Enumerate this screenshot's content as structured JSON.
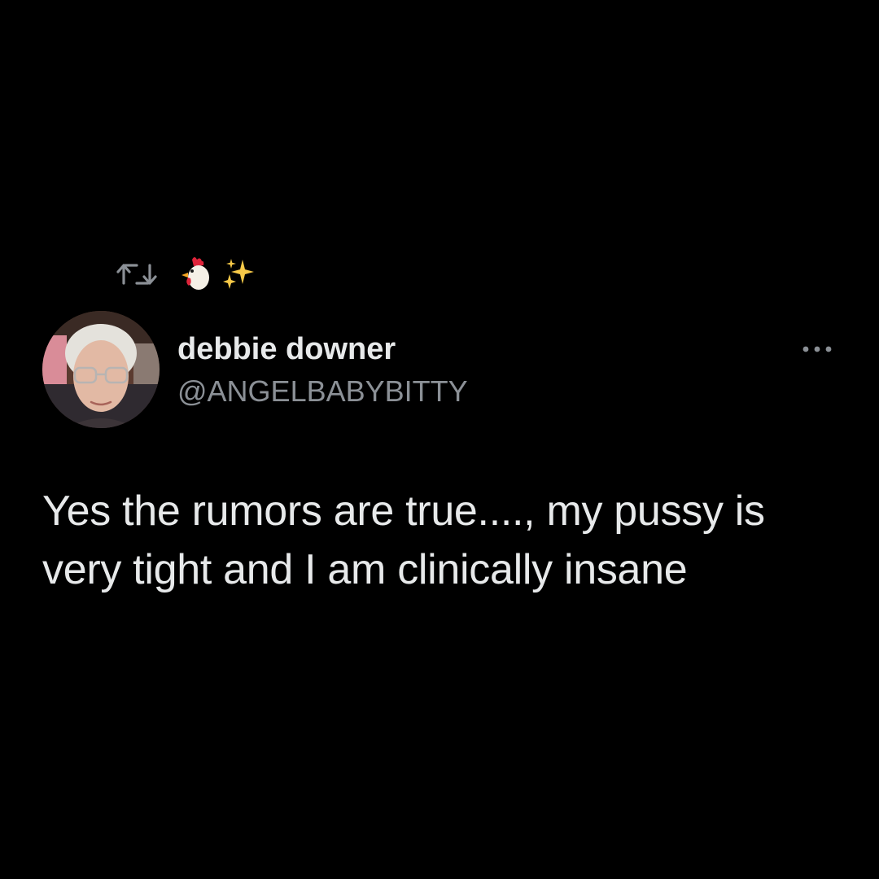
{
  "social_context": {
    "icon": "retweet-icon",
    "emojis": [
      "rooster-emoji",
      "sparkles-emoji"
    ]
  },
  "author": {
    "display_name": "debbie downer",
    "handle": "@ANGELBABYBITTY",
    "avatar": "avatar-photo"
  },
  "more_options": {
    "icon": "more-horizontal-icon"
  },
  "tweet": {
    "text": "Yes the rumors are true...., my pussy is very tight and I am clinically insane"
  },
  "colors": {
    "background": "#000000",
    "primary_text": "#e7e9ea",
    "secondary_text": "#8b9096"
  }
}
